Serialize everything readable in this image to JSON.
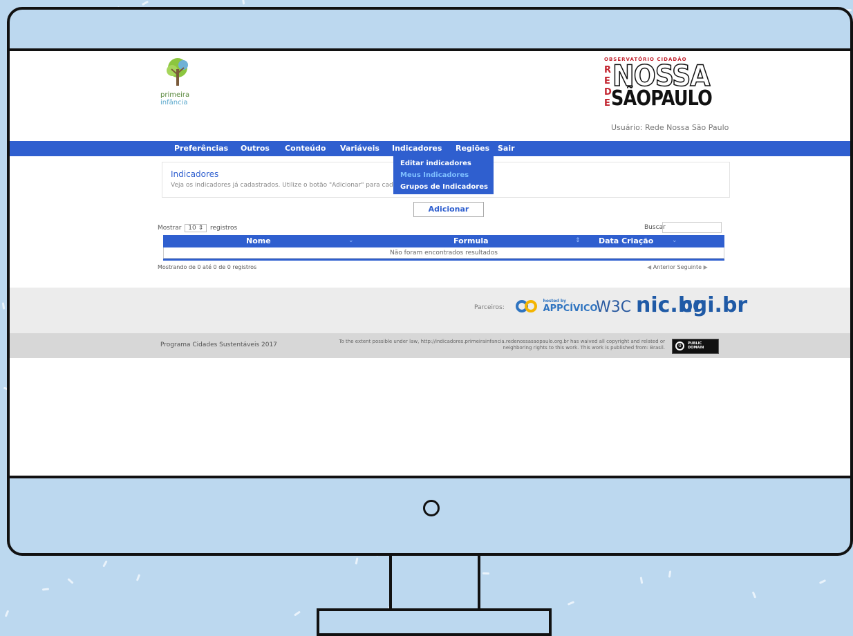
{
  "header": {
    "logo_left_lines": [
      "primeira",
      "infância"
    ],
    "logo_right_top": "OBSERVATÓRIO CIDADÃO",
    "logo_right_rede": [
      "R",
      "E",
      "D",
      "E"
    ],
    "logo_right_nossa": "NOSSA",
    "logo_right_sp": "SÃOPAULO",
    "user": "Usuário: Rede Nossa São Paulo"
  },
  "nav": {
    "items": [
      "Preferências",
      "Outros",
      "Conteúdo",
      "Variáveis",
      "Indicadores",
      "Regiões",
      "Sair"
    ],
    "dropdown": [
      "Editar indicadores",
      "Meus Indicadores",
      "Grupos de Indicadores"
    ]
  },
  "page": {
    "title": "Indicadores",
    "description": "Veja os indicadores já cadastrados. Utilize o botão \"Adicionar\" para cadastrar um novo indicador.",
    "add_label": "Adicionar"
  },
  "table": {
    "length_prefix": "Mostrar",
    "length_value": "10",
    "length_suffix": "registros",
    "search_label": "Buscar",
    "columns": [
      "Nome",
      "Formula",
      "Data Criação"
    ],
    "empty_message": "Não foram encontrados resultados",
    "info": "Mostrando de 0 até 0 de 0 registros",
    "prev": "Anterior",
    "next": "Seguinte"
  },
  "partners": {
    "label": "Parceiros:",
    "logos": [
      "APPCÍVICO",
      "W3C",
      "nic.br",
      "cgi.br"
    ],
    "appcivico_small": "hosted by"
  },
  "footer": {
    "left": "Programa Cidades Sustentáveis 2017",
    "middle": "To the extent possible under law, http://indicadores.primeirainfancia.redenossasaopaulo.org.br has waived all copyright and related or neighboring rights to this work. This work is published from: Brasil.",
    "badge": [
      "PUBLIC",
      "DOMAIN"
    ]
  },
  "colors": {
    "nav_blue": "#2f5fcf",
    "brand_red": "#c2242f",
    "background_blue": "#bcd8ef"
  }
}
